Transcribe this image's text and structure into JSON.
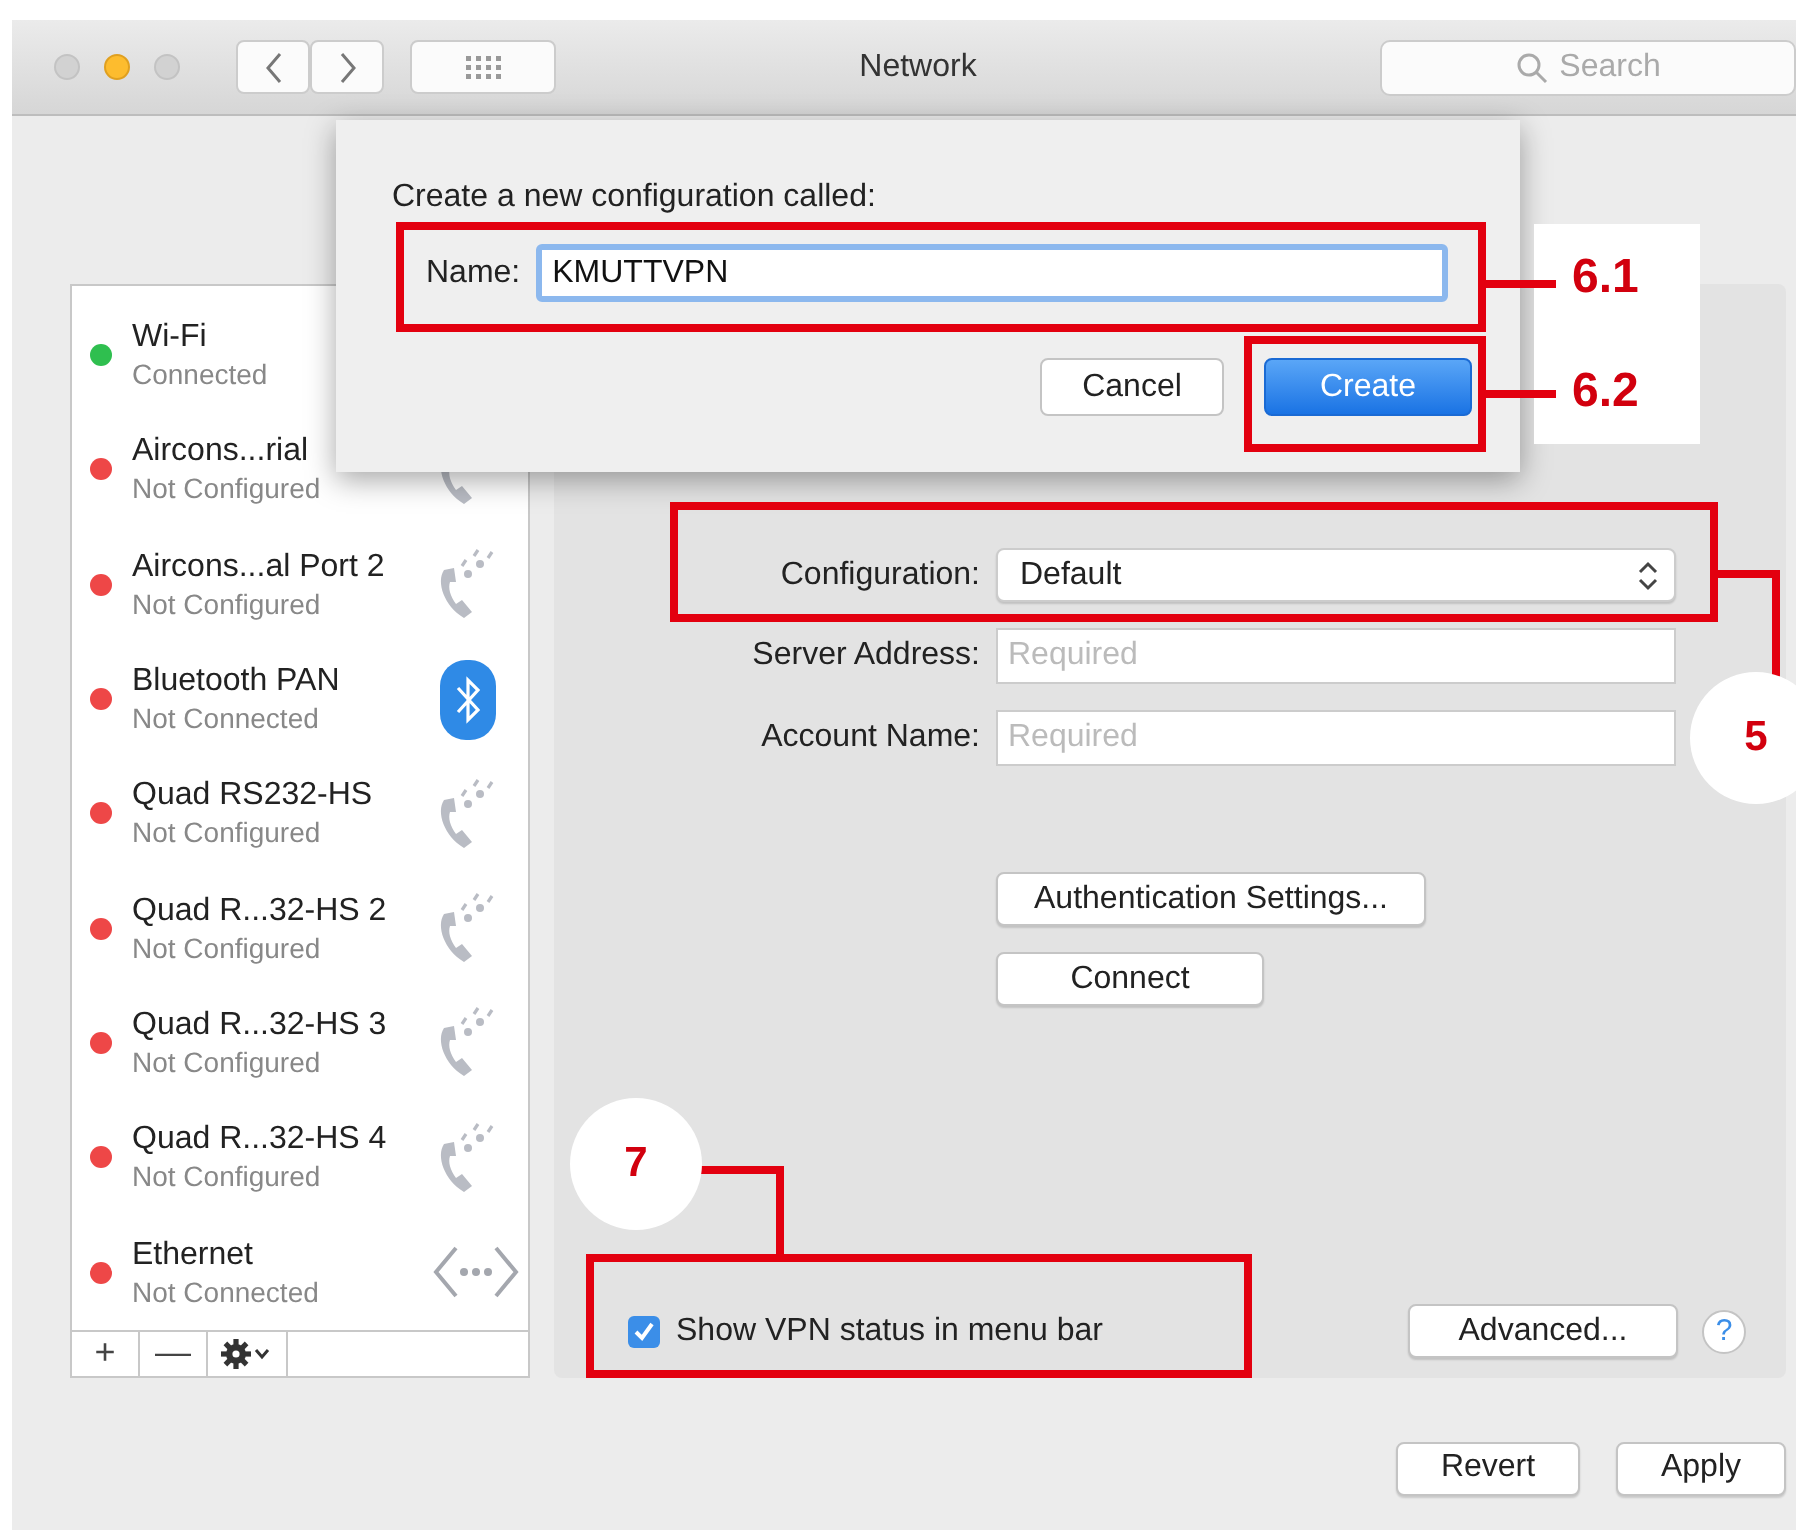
{
  "window": {
    "title": "Network"
  },
  "search": {
    "placeholder": "Search"
  },
  "services": [
    {
      "name": "Wi-Fi",
      "status": "Connected",
      "color": "#2fbf4f",
      "kind": "none"
    },
    {
      "name": "Aircons...rial",
      "status": "Not Configured",
      "color": "#ee4747",
      "kind": "phone"
    },
    {
      "name": "Aircons...al Port 2",
      "status": "Not Configured",
      "color": "#ee4747",
      "kind": "phone"
    },
    {
      "name": "Bluetooth PAN",
      "status": "Not Connected",
      "color": "#ee4747",
      "kind": "bluetooth"
    },
    {
      "name": "Quad RS232-HS",
      "status": "Not Configured",
      "color": "#ee4747",
      "kind": "phone"
    },
    {
      "name": "Quad R...32-HS 2",
      "status": "Not Configured",
      "color": "#ee4747",
      "kind": "phone"
    },
    {
      "name": "Quad R...32-HS 3",
      "status": "Not Configured",
      "color": "#ee4747",
      "kind": "phone"
    },
    {
      "name": "Quad R...32-HS 4",
      "status": "Not Configured",
      "color": "#ee4747",
      "kind": "phone"
    },
    {
      "name": "Ethernet",
      "status": "Not Connected",
      "color": "#ee4747",
      "kind": "ethernet"
    }
  ],
  "service_toolbar": {
    "add": "+",
    "remove": "—"
  },
  "vpn": {
    "configuration_label": "Configuration:",
    "configuration_value": "Default",
    "fields": [
      {
        "label": "Server Address:",
        "placeholder": "Required"
      },
      {
        "label": "Account Name:",
        "placeholder": "Required"
      }
    ],
    "buttons": [
      "Authentication Settings...",
      "Connect"
    ],
    "show_status": {
      "label": "Show VPN status in menu bar",
      "checked": true
    },
    "advanced": "Advanced...",
    "help": "?"
  },
  "footer_buttons": [
    "Revert",
    "Apply"
  ],
  "dialog": {
    "prompt": "Create a new configuration called:",
    "name_label": "Name:",
    "name_value": "KMUTTVPN",
    "buttons": [
      {
        "label": "Cancel",
        "default": false
      },
      {
        "label": "Create",
        "default": true
      }
    ]
  },
  "annotations": [
    {
      "label": "6.1"
    },
    {
      "label": "6.2"
    },
    {
      "label": "5"
    },
    {
      "label": "7"
    }
  ]
}
